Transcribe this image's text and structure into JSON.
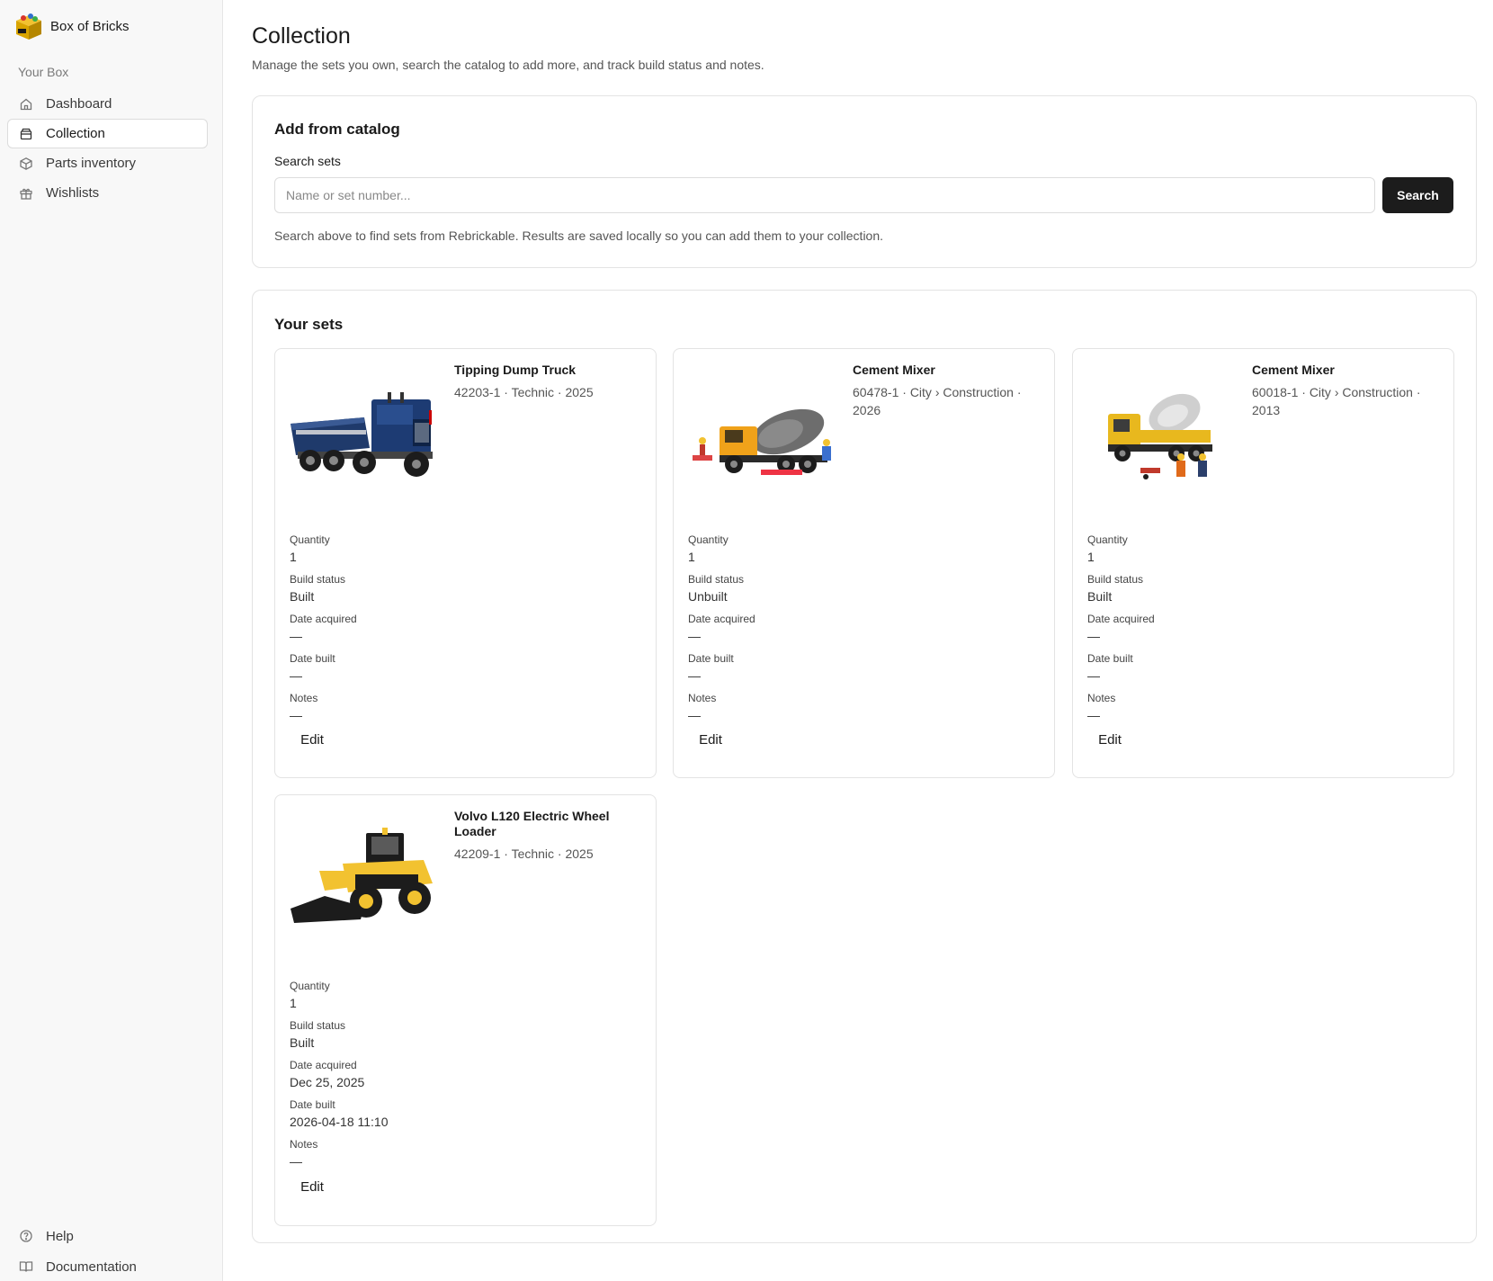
{
  "app": {
    "name": "Box of Bricks",
    "section_label": "Your Box"
  },
  "nav": {
    "items": [
      {
        "label": "Dashboard",
        "icon": "home-icon"
      },
      {
        "label": "Collection",
        "icon": "box-icon"
      },
      {
        "label": "Parts inventory",
        "icon": "package-icon"
      },
      {
        "label": "Wishlists",
        "icon": "gift-icon"
      }
    ],
    "active": "Collection",
    "footer": [
      {
        "label": "Help",
        "icon": "help-circle-icon"
      },
      {
        "label": "Documentation",
        "icon": "book-open-icon"
      }
    ]
  },
  "page": {
    "title": "Collection",
    "subtitle": "Manage the sets you own, search the catalog to add more, and track build status and notes."
  },
  "catalog": {
    "title": "Add from catalog",
    "search_label": "Search sets",
    "search_placeholder": "Name or set number...",
    "search_value": "",
    "search_button": "Search",
    "help_text": "Search above to find sets from Rebrickable. Results are saved locally so you can add them to your collection."
  },
  "sets_section": {
    "title": "Your sets",
    "field_labels": {
      "quantity": "Quantity",
      "build_status": "Build status",
      "date_acquired": "Date acquired",
      "date_built": "Date built",
      "notes": "Notes"
    },
    "edit_label": "Edit",
    "sets": [
      {
        "name": "Tipping Dump Truck",
        "meta": "42203-1 · Technic · 2025",
        "image": "dump-truck-image",
        "quantity": "1",
        "build_status": "Built",
        "date_acquired": "—",
        "date_built": "—",
        "notes": "—"
      },
      {
        "name": "Cement Mixer",
        "meta": "60478-1 · City › Construction · 2026",
        "image": "cement-mixer-image",
        "quantity": "1",
        "build_status": "Unbuilt",
        "date_acquired": "—",
        "date_built": "—",
        "notes": "—"
      },
      {
        "name": "Cement Mixer",
        "meta": "60018-1 · City › Construction · 2013",
        "image": "cement-mixer-image",
        "quantity": "1",
        "build_status": "Built",
        "date_acquired": "—",
        "date_built": "—",
        "notes": "—"
      },
      {
        "name": "Volvo L120 Electric Wheel Loader",
        "meta": "42209-1 · Technic · 2025",
        "image": "wheel-loader-image",
        "quantity": "1",
        "build_status": "Built",
        "date_acquired": "Dec 25, 2025",
        "date_built": "2026-04-18 11:10",
        "notes": "—"
      }
    ]
  },
  "colors": {
    "accent": "#1c1c1c",
    "sidebar_bg": "#f8f8f8",
    "border": "#e3e3e3"
  }
}
